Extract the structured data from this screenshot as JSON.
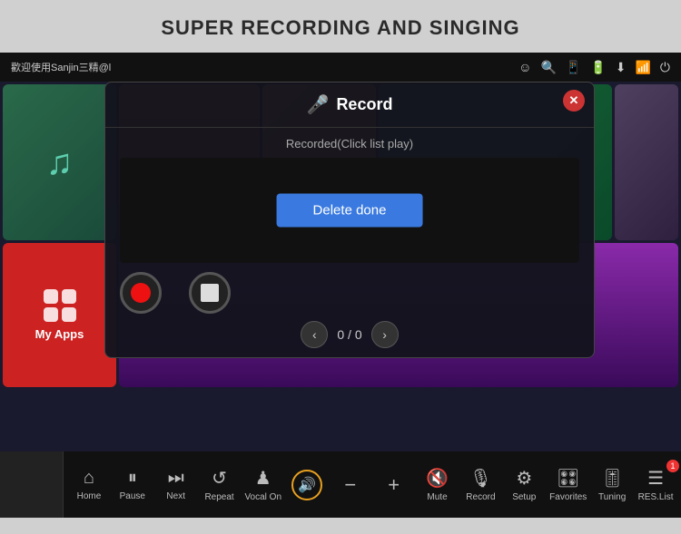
{
  "header": {
    "title": "SUPER RECORDING AND SINGING"
  },
  "status_bar": {
    "welcome": "歡迎使用Sanjin三精@l",
    "icons": [
      "smiley",
      "search",
      "tablet",
      "battery",
      "download",
      "wifi",
      "power"
    ]
  },
  "modal": {
    "title": "Record",
    "mic_symbol": "🎤",
    "recorded_label": "Recorded(Click list play)",
    "delete_done": "Delete done",
    "page_current": "0",
    "page_separator": "/",
    "page_total": "0"
  },
  "toolbar": {
    "items": [
      {
        "id": "home",
        "label": "Home",
        "icon": "⌂"
      },
      {
        "id": "pause",
        "label": "Pause",
        "icon": "⏸"
      },
      {
        "id": "next",
        "label": "Next",
        "icon": "⏭"
      },
      {
        "id": "repeat",
        "label": "Repeat",
        "icon": "🔁"
      },
      {
        "id": "vocal-on",
        "label": "Vocal On",
        "icon": "🎤"
      },
      {
        "id": "volume",
        "label": "",
        "icon": "🔊",
        "active": true
      },
      {
        "id": "vol-minus",
        "label": "",
        "icon": "−"
      },
      {
        "id": "vol-plus",
        "label": "",
        "icon": "+"
      },
      {
        "id": "mute",
        "label": "Mute",
        "icon": "🔇"
      },
      {
        "id": "record",
        "label": "Record",
        "icon": "🎙"
      },
      {
        "id": "setup",
        "label": "Setup",
        "icon": "⚙"
      },
      {
        "id": "favorites",
        "label": "Favorites",
        "icon": "★"
      },
      {
        "id": "tuning",
        "label": "Tuning",
        "icon": "🎚"
      },
      {
        "id": "res-list",
        "label": "RES.List",
        "icon": "☰",
        "badge": "1"
      }
    ]
  },
  "my_apps": {
    "label": "My Apps"
  }
}
